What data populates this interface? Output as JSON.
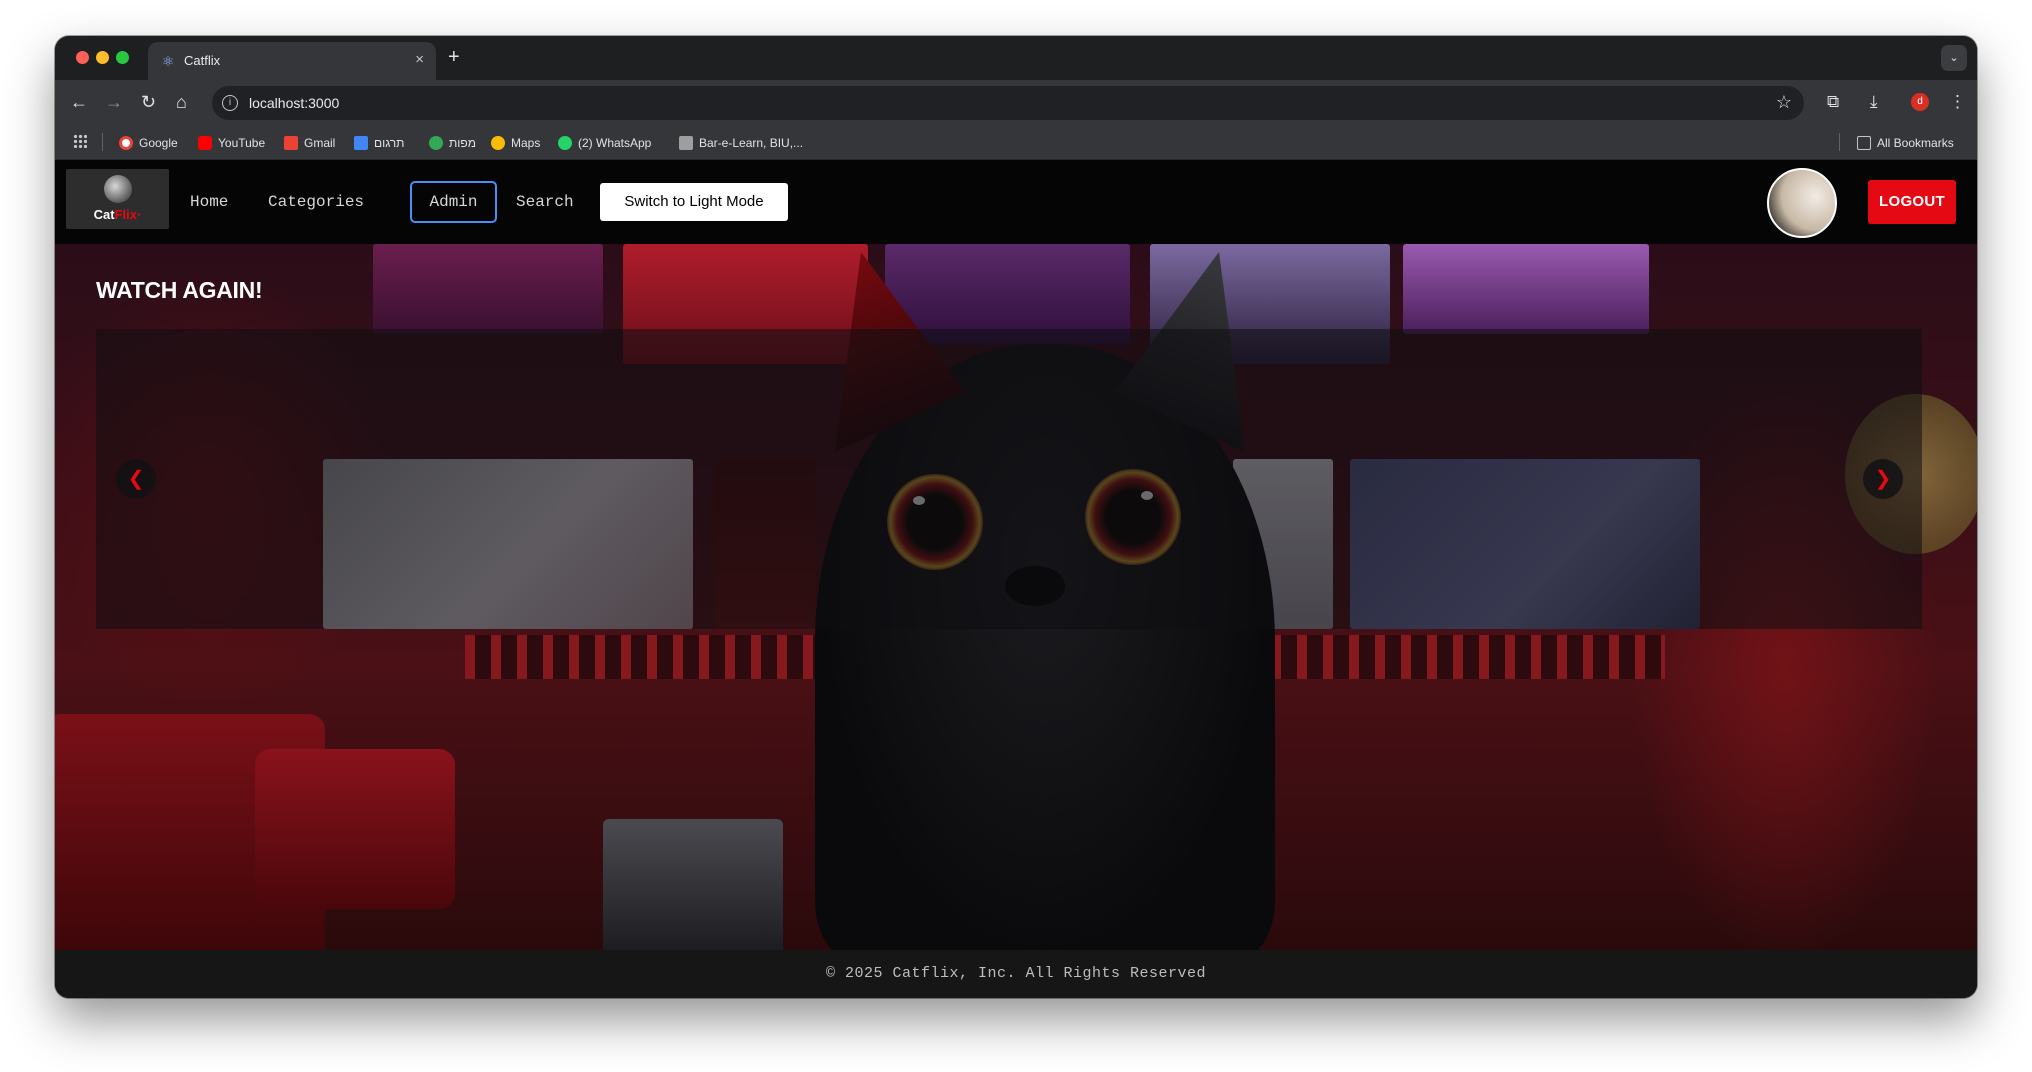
{
  "browser": {
    "tab_title": "Catflix",
    "tab_close": "×",
    "new_tab": "+",
    "url": "localhost:3000",
    "profile_initial": "d",
    "bookmarks": [
      {
        "label": "Google",
        "icon": "google-icon",
        "color": "#ea4335"
      },
      {
        "label": "YouTube",
        "icon": "youtube-icon",
        "color": "#ff0000"
      },
      {
        "label": "Gmail",
        "icon": "gmail-icon",
        "color": "#ea4335"
      },
      {
        "label": "תרגום",
        "icon": "translate-icon",
        "color": "#4285f4"
      },
      {
        "label": "מפות",
        "icon": "maps-icon",
        "color": "#34a853"
      },
      {
        "label": "Maps",
        "icon": "maps-icon",
        "color": "#fbbc04"
      },
      {
        "label": "(2) WhatsApp",
        "icon": "whatsapp-icon",
        "color": "#25d366"
      },
      {
        "label": "Bar-e-Learn, BIU,...",
        "icon": "moodle-icon",
        "color": "#bdbdbd"
      }
    ],
    "all_bookmarks": "All Bookmarks"
  },
  "site": {
    "logo": {
      "text_main": "Cat",
      "text_accent": "Flix",
      "text_dot": "·"
    },
    "nav": {
      "home": "Home",
      "categories": "Categories",
      "admin": "Admin",
      "search": "Search"
    },
    "theme_toggle": "Switch to Light Mode",
    "logout": "LOGOUT",
    "accent_color": "#e50914",
    "hero": {
      "section_title": "WATCH AGAIN!",
      "prev_arrow": "❮",
      "next_arrow": "❯"
    },
    "footer": "© 2025 Catflix, Inc. All Rights Reserved"
  }
}
